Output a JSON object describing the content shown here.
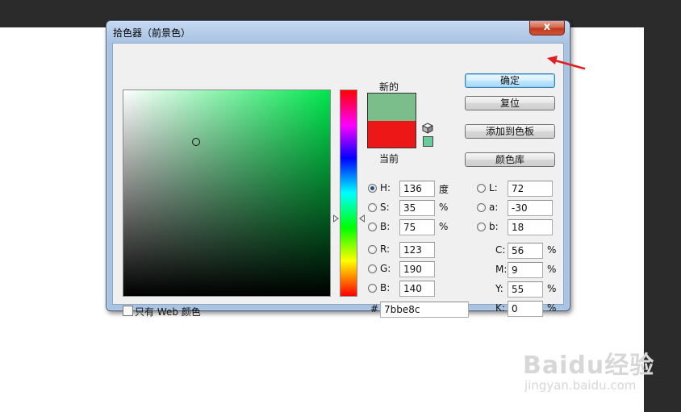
{
  "dialog": {
    "title": "拾色器（前景色）",
    "close_symbol": "x"
  },
  "swatches": {
    "new_label": "新的",
    "current_label": "当前",
    "new_color": "#7bbe8c",
    "current_color": "#ee1717",
    "web_safe_color": "#66cc99",
    "field_hue_color": "#00e64d"
  },
  "buttons": {
    "ok": "确定",
    "reset": "复位",
    "add_to_swatches": "添加到色板",
    "color_libraries": "颜色库"
  },
  "hsb": {
    "h_label": "H:",
    "h_value": "136",
    "h_unit": "度",
    "s_label": "S:",
    "s_value": "35",
    "s_unit": "%",
    "b_label": "B:",
    "b_value": "75",
    "b_unit": "%"
  },
  "rgb": {
    "r_label": "R:",
    "r_value": "123",
    "g_label": "G:",
    "g_value": "190",
    "b_label": "B:",
    "b_value": "140"
  },
  "lab": {
    "l_label": "L:",
    "l_value": "72",
    "a_label": "a:",
    "a_value": "-30",
    "b_label": "b:",
    "b_value": "18"
  },
  "cmyk": {
    "c_label": "C:",
    "c_value": "56",
    "c_unit": "%",
    "m_label": "M:",
    "m_value": "9",
    "m_unit": "%",
    "y_label": "Y:",
    "y_value": "55",
    "y_unit": "%",
    "k_label": "K:",
    "k_value": "0",
    "k_unit": "%"
  },
  "hex": {
    "label": "#",
    "value": "7bbe8c"
  },
  "web_only": {
    "label": "只有 Web 颜色",
    "checked": false
  },
  "picker": {
    "saturation": 0.35,
    "brightness": 0.75,
    "hue_fraction": 0.378
  },
  "watermark": {
    "brand": "Baidu经验",
    "sub": "jingyan.baidu.com"
  },
  "colors": {
    "annotation_arrow": "#e02020",
    "default_button_border": "#3c7fb1"
  }
}
